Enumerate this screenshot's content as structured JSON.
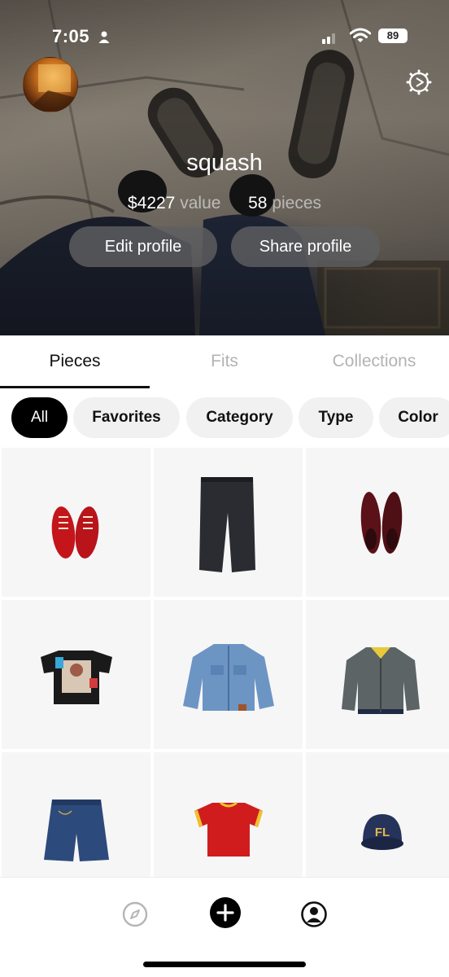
{
  "status_bar": {
    "time": "7:05",
    "battery": "89"
  },
  "profile": {
    "username": "squash",
    "value_amount": "$4227",
    "value_label": "value",
    "pieces_count": "58",
    "pieces_label": "pieces",
    "edit_button": "Edit profile",
    "share_button": "Share profile"
  },
  "tabs": [
    {
      "label": "Pieces",
      "active": true
    },
    {
      "label": "Fits",
      "active": false
    },
    {
      "label": "Collections",
      "active": false
    }
  ],
  "filters": [
    {
      "label": "All",
      "active": true
    },
    {
      "label": "Favorites",
      "active": false
    },
    {
      "label": "Category",
      "active": false
    },
    {
      "label": "Type",
      "active": false
    },
    {
      "label": "Color",
      "active": false
    }
  ],
  "pieces": [
    {
      "item": "red-sneakers"
    },
    {
      "item": "black-pants"
    },
    {
      "item": "burgundy-loafers"
    },
    {
      "item": "graphic-tshirt"
    },
    {
      "item": "denim-jacket"
    },
    {
      "item": "grey-varsity-jacket"
    },
    {
      "item": "denim-shorts"
    },
    {
      "item": "red-tshirt"
    },
    {
      "item": "navy-cap"
    }
  ],
  "cap_text": "FL",
  "bottom_nav": [
    {
      "icon": "compass-icon"
    },
    {
      "icon": "add-icon"
    },
    {
      "icon": "profile-icon"
    }
  ],
  "colors": {
    "accent": "#000000",
    "chip_bg": "#f1f1f1",
    "tab_inactive": "#b3b3b3",
    "button_bg": "#5f5f62"
  }
}
